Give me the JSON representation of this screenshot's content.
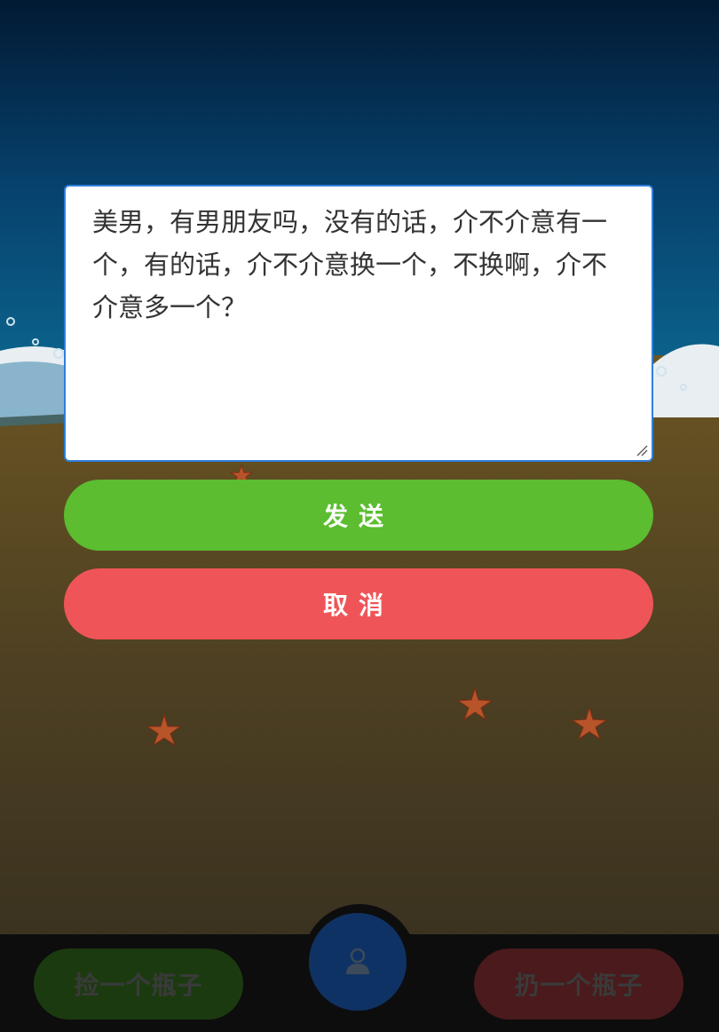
{
  "dialog": {
    "message": "美男，有男朋友吗，没有的话，介不介意有一个，有的话，介不介意换一个，不换啊，介不介意多一个？",
    "send_label": "发送",
    "cancel_label": "取消"
  },
  "bottom_nav": {
    "pick_label": "捡一个瓶子",
    "throw_label": "扔一个瓶子",
    "profile_icon": "user-icon"
  },
  "colors": {
    "send": "#5bbd2f",
    "cancel": "#ef5558",
    "input_border": "#2f7fdc"
  }
}
